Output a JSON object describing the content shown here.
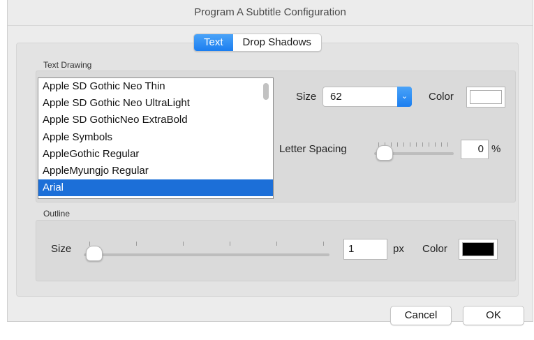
{
  "window": {
    "title": "Program A Subtitle Configuration"
  },
  "tabs": [
    {
      "label": "Text",
      "active": true
    },
    {
      "label": "Drop Shadows",
      "active": false
    }
  ],
  "text_drawing": {
    "group_label": "Text Drawing",
    "fonts": [
      "Apple SD Gothic Neo Thin",
      "Apple SD Gothic Neo UltraLight",
      "Apple SD GothicNeo ExtraBold",
      "Apple Symbols",
      "AppleGothic Regular",
      "AppleMyungjo Regular",
      "Arial"
    ],
    "selected_font": "Arial",
    "size_label": "Size",
    "size_value": "62",
    "color_label": "Color",
    "color_value": "#ffffff",
    "letter_spacing_label": "Letter Spacing",
    "letter_spacing_value": "0",
    "letter_spacing_unit": "%"
  },
  "outline": {
    "group_label": "Outline",
    "size_label": "Size",
    "size_value": "1",
    "unit": "px",
    "color_label": "Color",
    "color_value": "#000000"
  },
  "buttons": {
    "cancel": "Cancel",
    "ok": "OK"
  },
  "colors": {
    "accent": "#1b7ef0",
    "selection": "#1c6fd8"
  }
}
